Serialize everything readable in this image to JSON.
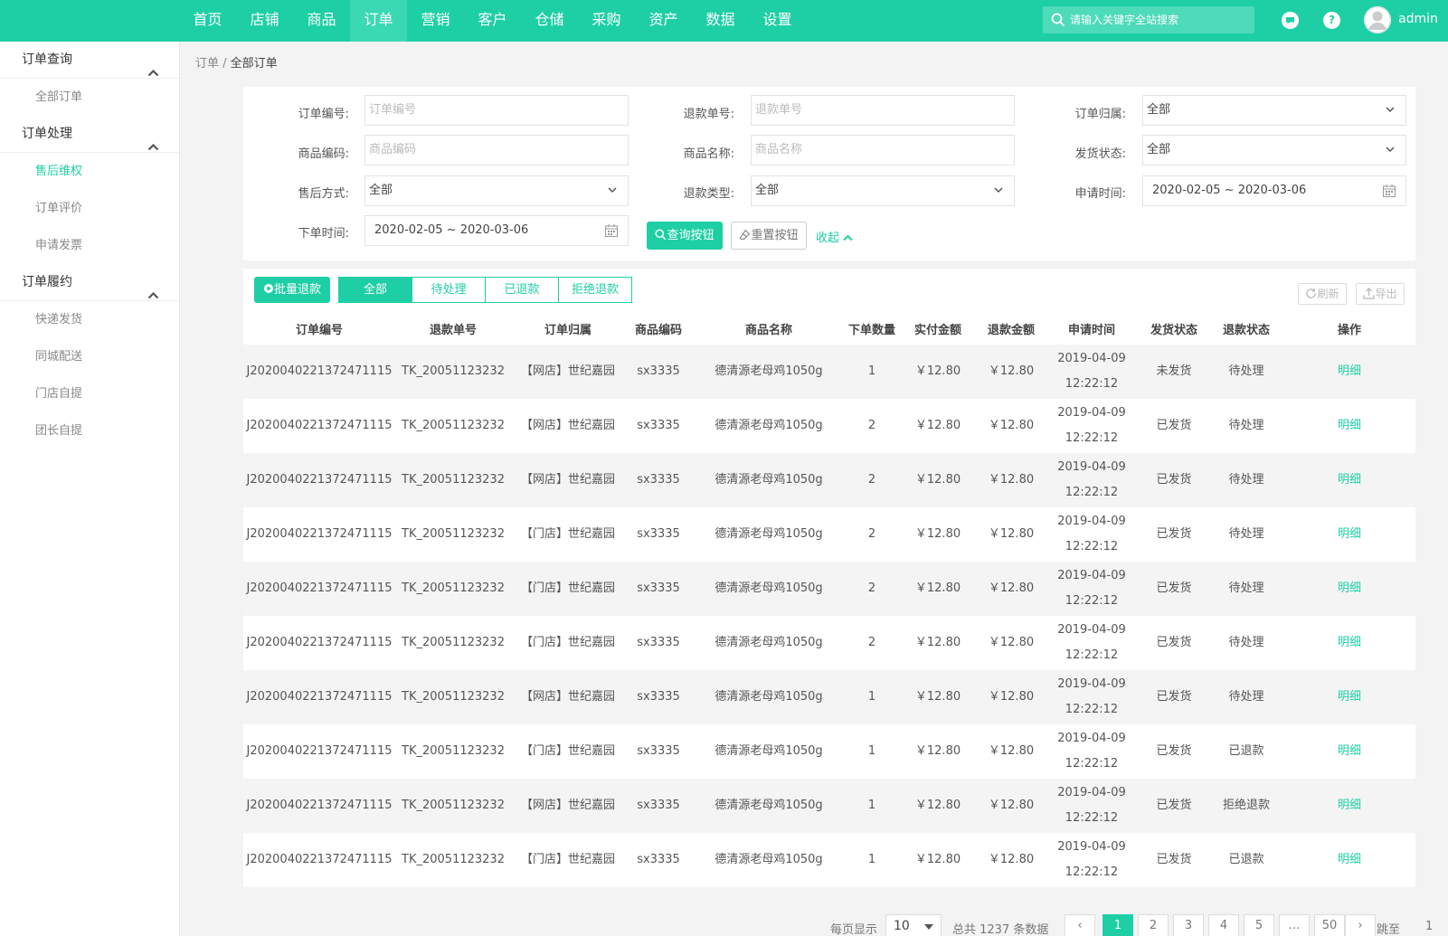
{
  "header": {
    "nav": [
      "首页",
      "店铺",
      "商品",
      "订单",
      "营销",
      "客户",
      "仓储",
      "采购",
      "资产",
      "数据",
      "设置"
    ],
    "active_nav": 3,
    "search_placeholder": "请输入关键字全站搜索",
    "username": "admin",
    "help_glyph": "?"
  },
  "sidebar": {
    "groups": [
      {
        "title": "订单查询",
        "items": [
          "全部订单"
        ]
      },
      {
        "title": "订单处理",
        "items": [
          "售后维权",
          "订单评价",
          "申请发票"
        ]
      },
      {
        "title": "订单履约",
        "items": [
          "快递发货",
          "同城配送",
          "门店自提",
          "团长自提"
        ]
      }
    ],
    "active_item": "售后维权"
  },
  "breadcrumb": {
    "parent": "订单",
    "sep": " / ",
    "current": "全部订单"
  },
  "filters": {
    "order_no_label": "订单编号:",
    "order_no_placeholder": "订单编号",
    "refund_no_label": "退款单号:",
    "refund_no_placeholder": "退款单号",
    "owner_label": "订单归属:",
    "owner_value": "全部",
    "goods_code_label": "商品编码:",
    "goods_code_placeholder": "商品编码",
    "goods_name_label": "商品名称:",
    "goods_name_placeholder": "商品名称",
    "ship_status_label": "发货状态:",
    "ship_status_value": "全部",
    "aftersale_label": "售后方式:",
    "aftersale_value": "全部",
    "refund_type_label": "退款类型:",
    "refund_type_value": "全部",
    "apply_time_label": "申请时间:",
    "apply_time_value": "2020-02-05 ~ 2020-03-06",
    "order_time_label": "下单时间:",
    "order_time_value": "2020-02-05 ~ 2020-03-06",
    "query_button": "查询按钮",
    "reset_button": "重置按钮",
    "collapse_link": "收起"
  },
  "toolbar": {
    "batch_refund": "批量退款",
    "tabs": [
      "全部",
      "待处理",
      "已退款",
      "拒绝退款"
    ],
    "active_tab": 0,
    "refresh": "刷新",
    "export": "导出"
  },
  "table": {
    "columns": [
      "订单编号",
      "退款单号",
      "订单归属",
      "商品编码",
      "商品名称",
      "下单数量",
      "实付金额",
      "退款金额",
      "申请时间",
      "发货状态",
      "退款状态",
      "操作"
    ],
    "rows": [
      [
        "J2020040221372471115",
        "TK_20051123232",
        "【网店】世纪嘉园",
        "sx3335",
        "德清源老母鸡1050g",
        "1",
        "￥12.80",
        "￥12.80",
        "2019-04-09",
        "12:22:12",
        "未发货",
        "待处理",
        "明细"
      ],
      [
        "J2020040221372471115",
        "TK_20051123232",
        "【网店】世纪嘉园",
        "sx3335",
        "德清源老母鸡1050g",
        "2",
        "￥12.80",
        "￥12.80",
        "2019-04-09",
        "12:22:12",
        "已发货",
        "待处理",
        "明细"
      ],
      [
        "J2020040221372471115",
        "TK_20051123232",
        "【网店】世纪嘉园",
        "sx3335",
        "德清源老母鸡1050g",
        "2",
        "￥12.80",
        "￥12.80",
        "2019-04-09",
        "12:22:12",
        "已发货",
        "待处理",
        "明细"
      ],
      [
        "J2020040221372471115",
        "TK_20051123232",
        "【门店】世纪嘉园",
        "sx3335",
        "德清源老母鸡1050g",
        "2",
        "￥12.80",
        "￥12.80",
        "2019-04-09",
        "12:22:12",
        "已发货",
        "待处理",
        "明细"
      ],
      [
        "J2020040221372471115",
        "TK_20051123232",
        "【门店】世纪嘉园",
        "sx3335",
        "德清源老母鸡1050g",
        "2",
        "￥12.80",
        "￥12.80",
        "2019-04-09",
        "12:22:12",
        "已发货",
        "待处理",
        "明细"
      ],
      [
        "J2020040221372471115",
        "TK_20051123232",
        "【门店】世纪嘉园",
        "sx3335",
        "德清源老母鸡1050g",
        "2",
        "￥12.80",
        "￥12.80",
        "2019-04-09",
        "12:22:12",
        "已发货",
        "待处理",
        "明细"
      ],
      [
        "J2020040221372471115",
        "TK_20051123232",
        "【网店】世纪嘉园",
        "sx3335",
        "德清源老母鸡1050g",
        "1",
        "￥12.80",
        "￥12.80",
        "2019-04-09",
        "12:22:12",
        "已发货",
        "待处理",
        "明细"
      ],
      [
        "J2020040221372471115",
        "TK_20051123232",
        "【门店】世纪嘉园",
        "sx3335",
        "德清源老母鸡1050g",
        "1",
        "￥12.80",
        "￥12.80",
        "2019-04-09",
        "12:22:12",
        "已发货",
        "已退款",
        "明细"
      ],
      [
        "J2020040221372471115",
        "TK_20051123232",
        "【网店】世纪嘉园",
        "sx3335",
        "德清源老母鸡1050g",
        "1",
        "￥12.80",
        "￥12.80",
        "2019-04-09",
        "12:22:12",
        "已发货",
        "拒绝退款",
        "明细"
      ],
      [
        "J2020040221372471115",
        "TK_20051123232",
        "【门店】世纪嘉园",
        "sx3335",
        "德清源老母鸡1050g",
        "1",
        "￥12.80",
        "￥12.80",
        "2019-04-09",
        "12:22:12",
        "已发货",
        "已退款",
        "明细"
      ]
    ]
  },
  "pagination": {
    "per_page_label": "每页显示",
    "per_page_value": "10",
    "total_text": "总共 1237 条数据",
    "prev": "‹",
    "pages": [
      "1",
      "2",
      "3",
      "4",
      "5",
      "…",
      "50"
    ],
    "active_page": "1",
    "next": "›",
    "goto_label": "跳至",
    "goto_value": "1"
  },
  "colors": {
    "brand": "#1ecfa5"
  }
}
